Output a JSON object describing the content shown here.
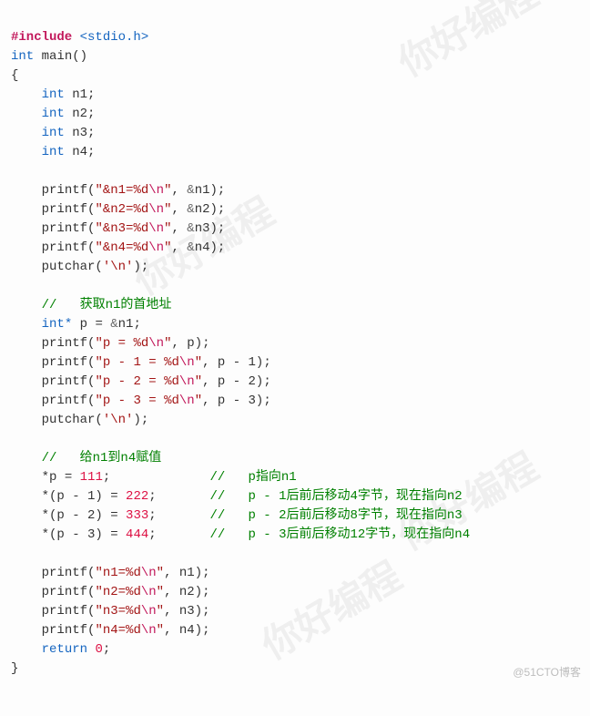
{
  "watermark": "你好编程",
  "credit": "@51CTO博客",
  "code": {
    "include_directive": "#include",
    "include_header": "<stdio.h>",
    "kw_int": "int",
    "kw_int_ptr": "int*",
    "kw_return": "return",
    "fn_main": "main",
    "fn_printf": "printf",
    "fn_putchar": "putchar",
    "decl": {
      "n1": "n1",
      "n2": "n2",
      "n3": "n3",
      "n4": "n4",
      "p": "p"
    },
    "addr_print": [
      {
        "str_open": "\"&n1=",
        "fmt": "%d",
        "esc": "\\n",
        "str_close": "\"",
        "arg_amp": "&",
        "arg_name": "n1"
      },
      {
        "str_open": "\"&n2=",
        "fmt": "%d",
        "esc": "\\n",
        "str_close": "\"",
        "arg_amp": "&",
        "arg_name": "n2"
      },
      {
        "str_open": "\"&n3=",
        "fmt": "%d",
        "esc": "\\n",
        "str_close": "\"",
        "arg_amp": "&",
        "arg_name": "n3"
      },
      {
        "str_open": "\"&n4=",
        "fmt": "%d",
        "esc": "\\n",
        "str_close": "\"",
        "arg_amp": "&",
        "arg_name": "n4"
      }
    ],
    "putchar_arg": "'\\n'",
    "comment1": "//   获取n1的首地址",
    "p_assign": {
      "amp": "&",
      "name": "n1"
    },
    "p_print": [
      {
        "str": "\"p = %d\\n\"",
        "str_open": "\"p = ",
        "fmt": "%d",
        "esc": "\\n",
        "str_close": "\"",
        "arg": "p"
      },
      {
        "str_open": "\"p - 1 = ",
        "fmt": "%d",
        "esc": "\\n",
        "str_close": "\"",
        "arg": "p - 1"
      },
      {
        "str_open": "\"p - 2 = ",
        "fmt": "%d",
        "esc": "\\n",
        "str_close": "\"",
        "arg": "p - 2"
      },
      {
        "str_open": "\"p - 3 = ",
        "fmt": "%d",
        "esc": "\\n",
        "str_close": "\"",
        "arg": "p - 3"
      }
    ],
    "comment2": "//   给n1到n4赋值",
    "assign": [
      {
        "lhs": "*p",
        "val": "111",
        "cmt": "//   p指向n1"
      },
      {
        "lhs": "*(p - 1)",
        "val": "222",
        "cmt": "//   p - 1后前后移动4字节，现在指向n2"
      },
      {
        "lhs": "*(p - 2)",
        "val": "333",
        "cmt": "//   p - 2后前后移动8字节，现在指向n3"
      },
      {
        "lhs": "*(p - 3)",
        "val": "444",
        "cmt": "//   p - 3后前后移动12字节，现在指向n4"
      }
    ],
    "final_print": [
      {
        "str_open": "\"n1=",
        "fmt": "%d",
        "esc": "\\n",
        "str_close": "\"",
        "arg": "n1"
      },
      {
        "str_open": "\"n2=",
        "fmt": "%d",
        "esc": "\\n",
        "str_close": "\"",
        "arg": "n2"
      },
      {
        "str_open": "\"n3=",
        "fmt": "%d",
        "esc": "\\n",
        "str_close": "\"",
        "arg": "n3"
      },
      {
        "str_open": "\"n4=",
        "fmt": "%d",
        "esc": "\\n",
        "str_close": "\"",
        "arg": "n4"
      }
    ],
    "return_val": "0"
  }
}
